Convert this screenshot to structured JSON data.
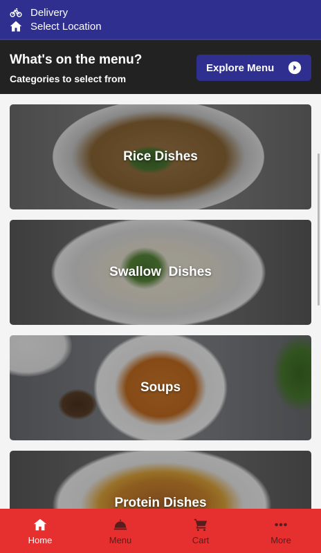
{
  "topbar": {
    "delivery_label": "Delivery",
    "location_label": "Select Location",
    "bg_color": "#2e2f8f"
  },
  "menu_header": {
    "title": "What's on the menu?",
    "subtitle": "Categories to select from",
    "explore_label": "Explore Menu"
  },
  "categories": [
    {
      "label": "Rice Dishes"
    },
    {
      "label": "Swallow  Dishes"
    },
    {
      "label": "Soups"
    },
    {
      "label": "Protein Dishes"
    }
  ],
  "bottom_nav": {
    "bg_color": "#e63030",
    "items": [
      {
        "label": "Home",
        "icon": "home-icon",
        "active": true
      },
      {
        "label": "Menu",
        "icon": "cloche-icon",
        "active": false
      },
      {
        "label": "Cart",
        "icon": "cart-icon",
        "active": false
      },
      {
        "label": "More",
        "icon": "more-dots-icon",
        "active": false
      }
    ]
  }
}
